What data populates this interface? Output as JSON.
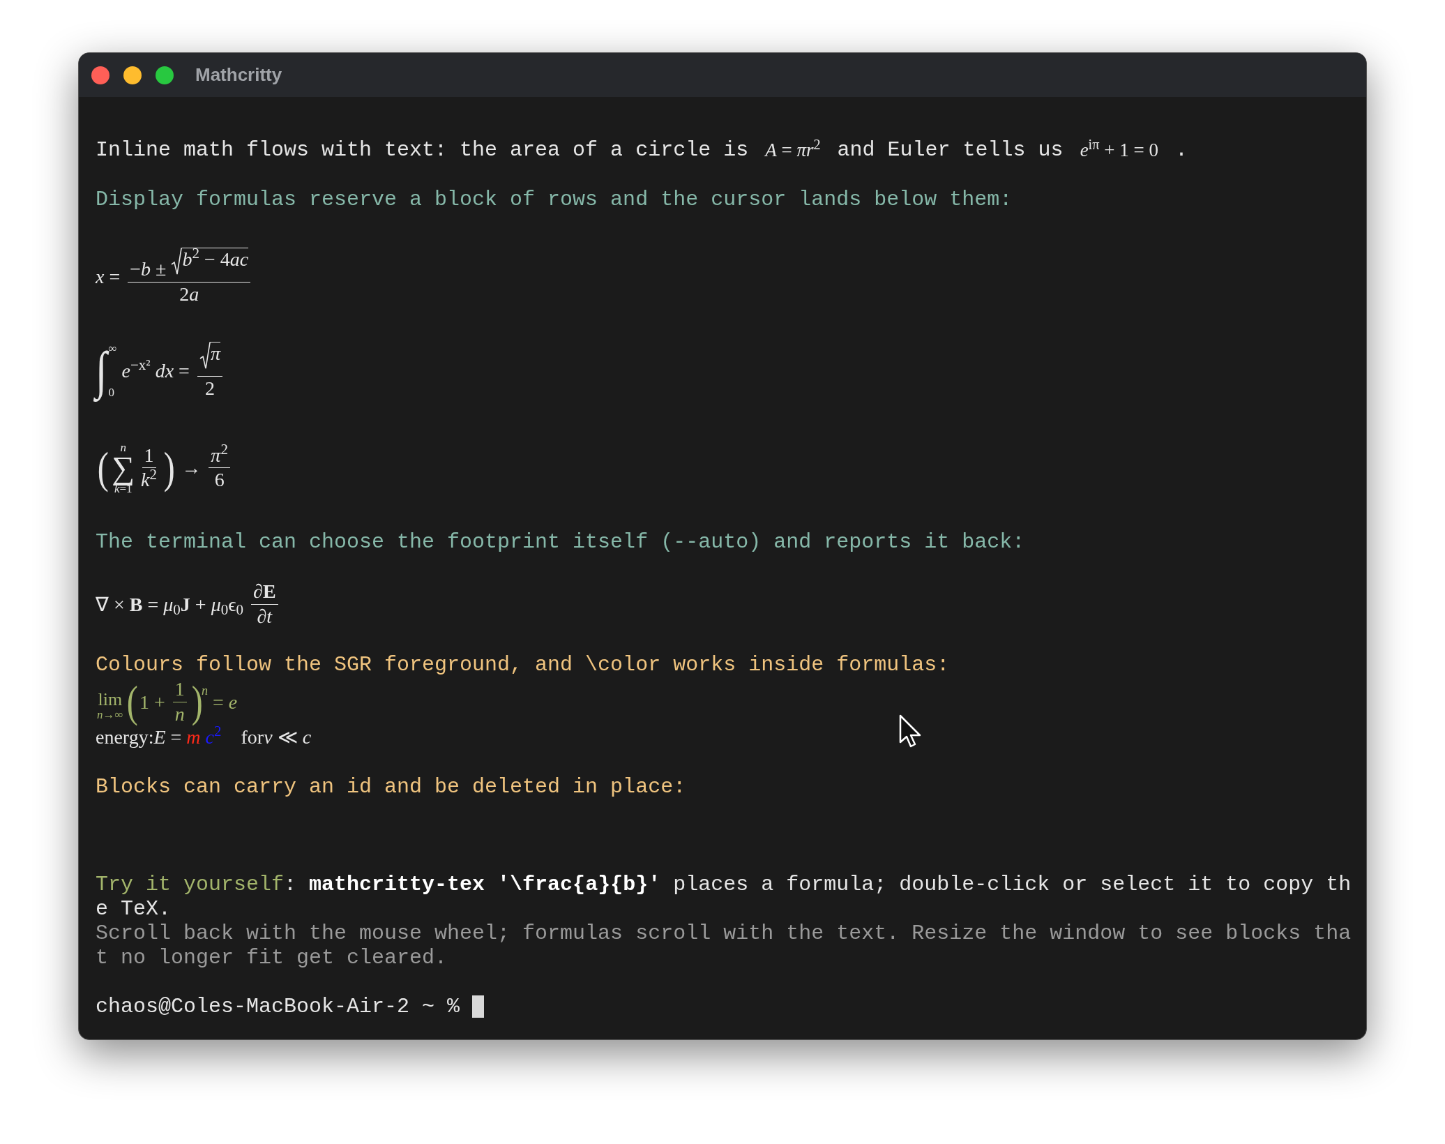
{
  "window": {
    "title": "Mathcritty"
  },
  "lines": [
    {
      "kind": "text",
      "color": "#e6e6e6",
      "runs": [
        {
          "kind": "text",
          "s": "Inline math flows with text: the area of a circle is "
        },
        {
          "kind": "math",
          "body": [
            {
              "kind": "t",
              "s": "*A* = *πr*$^{2}$"
            }
          ]
        },
        {
          "kind": "text",
          "s": " and Euler tells us "
        },
        {
          "kind": "math",
          "body": [
            {
              "kind": "t",
              "s": "*e*$^{iπ}$ + 1 = 0"
            }
          ]
        },
        {
          "kind": "text",
          "s": " ."
        }
      ]
    },
    {
      "kind": "text",
      "color": "#86b8a9",
      "runs": [
        {
          "kind": "text",
          "s": "Display formulas reserve a block of rows and the cursor lands below them:"
        }
      ]
    },
    {
      "kind": "formula",
      "body": [
        {
          "kind": "t",
          "s": "*x* = "
        },
        {
          "kind": "frac",
          "num": [
            {
              "kind": "t",
              "s": "−*b* ± "
            },
            {
              "kind": "sqrt",
              "body": [
                {
                  "kind": "t",
                  "s": "*b*$^{2}$ − 4"
                },
                {
                  "kind": "t",
                  "s": "*ac*"
                }
              ]
            }
          ],
          "den": [
            {
              "kind": "t",
              "s": "2"
            },
            {
              "kind": "t",
              "s": "*a*"
            }
          ]
        }
      ]
    },
    {
      "kind": "formula",
      "body": [
        {
          "kind": "int",
          "op": "∫",
          "sup": "∞",
          "sub": "0"
        },
        {
          "kind": "t",
          "s": " *e*$^{−x²}$ *dx* = "
        },
        {
          "kind": "frac",
          "num": [
            {
              "kind": "sqrt",
              "body": [
                {
                  "kind": "t",
                  "s": "*π*"
                }
              ]
            }
          ],
          "den": [
            {
              "kind": "t",
              "s": "2"
            }
          ]
        }
      ]
    },
    {
      "kind": "formula",
      "body": [
        {
          "kind": "paren",
          "open": "(",
          "close": ")",
          "body": [
            {
              "kind": "bigop",
              "op": "∑",
              "over": "*n*",
              "under": "*k*=1"
            },
            {
              "kind": "frac",
              "num": [
                {
                  "kind": "t",
                  "s": "1"
                }
              ],
              "den": [
                {
                  "kind": "t",
                  "s": "*k*$^{2}$"
                }
              ]
            }
          ]
        },
        {
          "kind": "t",
          "s": " → "
        },
        {
          "kind": "frac",
          "num": [
            {
              "kind": "t",
              "s": "*π*$^{2}$"
            }
          ],
          "den": [
            {
              "kind": "t",
              "s": "6"
            }
          ]
        }
      ]
    },
    {
      "kind": "text",
      "color": "#86b8a9",
      "runs": [
        {
          "kind": "text",
          "s": "The terminal can choose the footprint itself (--auto) and reports it back:"
        }
      ]
    },
    {
      "kind": "formula",
      "body": [
        {
          "kind": "t",
          "s": "∇ × **B** = *μ*$_{0}$**J** + *μ*$_{0}$ϵ$_{0}$ "
        },
        {
          "kind": "frac",
          "num": [
            {
              "kind": "t",
              "s": "∂**E**"
            }
          ],
          "den": [
            {
              "kind": "t",
              "s": "∂*t*"
            }
          ]
        }
      ]
    },
    {
      "kind": "text",
      "color": "#f0c47f",
      "runs": [
        {
          "kind": "text",
          "s": "Colours follow the SGR foreground, and \\color works inside formulas:"
        }
      ]
    },
    {
      "kind": "formula",
      "color": "#a3b56b",
      "body": [
        {
          "kind": "limop",
          "op": "lim",
          "under": "*n*→∞"
        },
        {
          "kind": "paren",
          "open": "(",
          "close": ")",
          "sup": "*n*",
          "body": [
            {
              "kind": "t",
              "s": "1 + "
            },
            {
              "kind": "frac",
              "num": [
                {
                  "kind": "t",
                  "s": "1"
                }
              ],
              "den": [
                {
                  "kind": "t",
                  "s": "*n*"
                }
              ]
            }
          ]
        },
        {
          "kind": "t",
          "s": " = *e*"
        }
      ]
    },
    {
      "kind": "formula",
      "body": [
        {
          "kind": "t",
          "s": "energy:*E* = "
        },
        {
          "kind": "t",
          "s": "*m*",
          "color": "#ff2a1a"
        },
        {
          "kind": "t",
          "s": " *c*$^{2}$",
          "color": "#1a1aff"
        },
        {
          "kind": "t",
          "s": "    for"
        },
        {
          "kind": "t",
          "s": "*v* ≪ *c*"
        }
      ]
    },
    {
      "kind": "text",
      "color": "#f0c47f",
      "runs": [
        {
          "kind": "text",
          "s": "Blocks can carry an id and be deleted in place:"
        }
      ]
    },
    {
      "kind": "para",
      "paragraphs": [
        {
          "color": "#e6e6e6",
          "runs": [
            {
              "s": "Try it yourself",
              "color": "#a3b56b",
              "bold": false
            },
            {
              "s": ": ",
              "bold": false
            },
            {
              "s": "mathcritty-tex '\\frac{a}{b}'",
              "bold": true
            },
            {
              "s": " places a formula; double-click or select it to copy the TeX.",
              "bold": false
            }
          ]
        },
        {
          "color": "#9a9a9a",
          "runs": [
            {
              "s": "Scroll back with the mouse wheel; formulas scroll with the text. Resize the window to see blocks that no longer fit get cleared.",
              "bold": false
            }
          ]
        }
      ]
    },
    {
      "kind": "prompt",
      "s": "chaos@Coles-MacBook-Air-2 ~ %",
      "cursor": true
    }
  ]
}
